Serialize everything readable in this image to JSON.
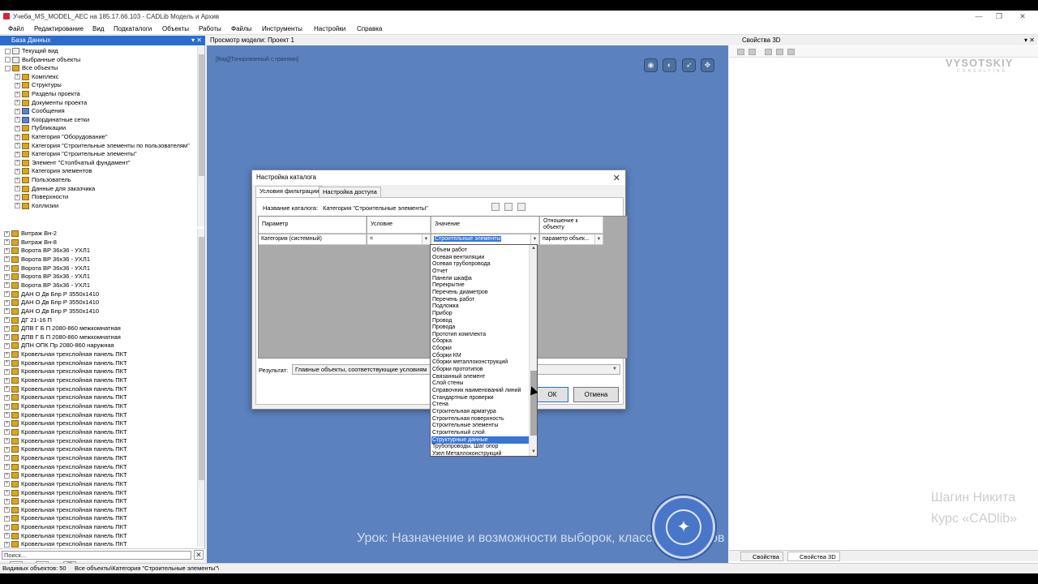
{
  "window": {
    "title": "Учеба_MS_MODEL_AEC на 185.17.66.103 - CADLib Модель и Архив",
    "controls": [
      "—",
      "❐",
      "✕"
    ]
  },
  "menu": [
    "Файл",
    "Редактирование",
    "Вид",
    "Подкаталоги",
    "Объекты",
    "Работы",
    "Файлы",
    "Инструменты",
    "Настройки",
    "Справка"
  ],
  "left_panel": {
    "title": "База Данных",
    "pin": "▾ ✕",
    "top_tree": [
      "Текущий вид",
      "Выбранные объекты",
      "Все объекты",
      "Комплекс",
      "Структуры",
      "Разделы проекта",
      "Документы проекта",
      "Сообщения",
      "Координатные сетки",
      "Публикации",
      "Категория \"Оборудование\"",
      "Категория \"Строительные элементы по пользователям\"",
      "Категория \"Строительные элементы\"",
      "Элемент \"Столбчатый фундамент\"",
      "Категория элементов",
      "Пользователь",
      "Данные для заказчика",
      "Поверхности",
      "Коллизии"
    ],
    "bottom_list": [
      "Витраж Вн-2",
      "Витраж Вн-8",
      "Ворота ВР 36х36 - УХЛ1",
      "Ворота ВР 36х36 - УХЛ1",
      "Ворота ВР 36х36 - УХЛ1",
      "Ворота ВР 36х36 - УХЛ1",
      "Ворота ВР 36х36 - УХЛ1",
      "ДАН О Дв Бпр Р 3550х1410",
      "ДАН О Дв Бпр Р 3550х1410",
      "ДАН О Дв Бпр Р 3550х1410",
      "ДГ 21-16 П",
      "ДПВ Г Б П 2080-860 межкомнатная",
      "ДПВ Г Б П 2080-860 межкомнатная",
      "ДПН ОПК Пр 2080-860 наружная",
      "Кровельная трехслойная панель ПКТ",
      "Кровельная трехслойная панель ПКТ",
      "Кровельная трехслойная панель ПКТ",
      "Кровельная трехслойная панель ПКТ",
      "Кровельная трехслойная панель ПКТ",
      "Кровельная трехслойная панель ПКТ",
      "Кровельная трехслойная панель ПКТ",
      "Кровельная трехслойная панель ПКТ",
      "Кровельная трехслойная панель ПКТ",
      "Кровельная трехслойная панель ПКТ",
      "Кровельная трехслойная панель ПКТ",
      "Кровельная трехслойная панель ПКТ",
      "Кровельная трехслойная панель ПКТ",
      "Кровельная трехслойная панель ПКТ",
      "Кровельная трехслойная панель ПКТ",
      "Кровельная трехслойная панель ПКТ",
      "Кровельная трехслойная панель ПКТ",
      "Кровельная трехслойная панель ПКТ",
      "Кровельная трехслойная панель ПКТ",
      "Кровельная трехслойная панель ПКТ",
      "Кровельная трехслойная панель ПКТ",
      "Кровельная трехслойная панель ПКТ",
      "Кровельная трехслойная панель ПКТ",
      "Кровельная трехслойная панель ПКТ"
    ],
    "search_placeholder": "Поиск...",
    "search_clear": "✕",
    "nav": [
      "≪",
      "≫",
      "▤"
    ]
  },
  "status": {
    "visible": "Видимых объектов: 50",
    "path": "Все объекты\\Категория \"Строительные элементы\"\\"
  },
  "viewport": {
    "title": "Просмотр модели: Проект 1",
    "label": "[Вид][Тонированный с гранями]",
    "buttons": [
      "◉",
      "◐",
      "➶",
      "✥"
    ]
  },
  "right_panel": {
    "title": "Свойства 3D",
    "pin": "▾ ✕",
    "tabs": [
      "Свойства",
      "Свойства 3D"
    ],
    "brand": "VYSOTSKIY",
    "brand_sub": "CONSULTING"
  },
  "overlay": {
    "lesson": "Урок: Назначение и возможности выборок, классификаторов и миникаталогов в базе данных",
    "author": "Шагин Никита",
    "course": "Курс «CADlib»"
  },
  "dialog": {
    "title": "Настройка каталога",
    "close": "✕",
    "tabs": [
      "Условия фильтрации",
      "Настройка доступа"
    ],
    "catalog_label": "Название каталога:",
    "catalog_name": "Категория \"Строительные элементы\"",
    "columns": [
      "Параметр",
      "Условие",
      "Значение",
      "Отношение к объекту"
    ],
    "row": {
      "param": "Категория (системный)",
      "cond": "=",
      "value": "Строительные элементы",
      "relation": "параметр объек..."
    },
    "result_label": "Результат:",
    "result_value": "Главные объекты, соответствующие условиям",
    "ok": "ОК",
    "cancel": "Отмена"
  },
  "dropdown": {
    "items": [
      "Объем работ",
      "Осевая вентиляции",
      "Осевая трубопровода",
      "Отчет",
      "Панели шкафа",
      "Перекрытие",
      "Перечень диаметров",
      "Перечень работ",
      "Подложка",
      "Прибор",
      "Провод",
      "Провода",
      "Прототип комплекта",
      "Сборка",
      "Сборки",
      "Сборки КМ",
      "Сборки металлоконструкций",
      "Сборки прототипов",
      "Связанный элемент",
      "Слой стены",
      "Справочник наименований линий",
      "Стандартные проверки",
      "Стена",
      "Строительная арматура",
      "Строительная поверхность",
      "Строительные элементы",
      "Строительный слой",
      "Структурные данные",
      "Трубопроводы. Шаг опор",
      "Узел Металлоконструкций"
    ],
    "highlighted": "Структурные данные"
  }
}
